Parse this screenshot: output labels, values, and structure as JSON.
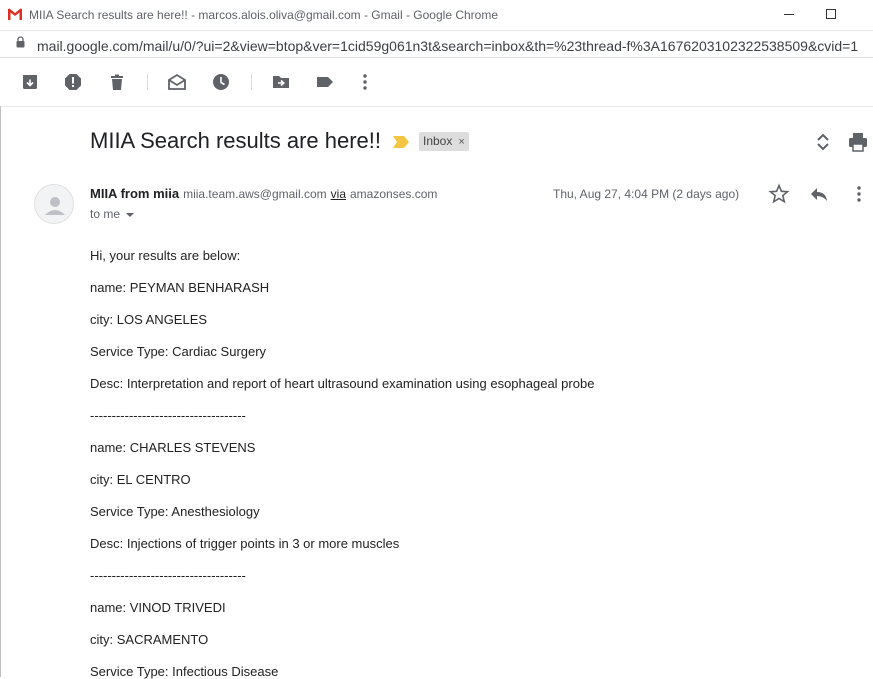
{
  "window": {
    "title": "MIIA Search results are here!! - marcos.alois.oliva@gmail.com - Gmail - Google Chrome"
  },
  "address_bar": {
    "url": "mail.google.com/mail/u/0/?ui=2&view=btop&ver=1cid59g061n3t&search=inbox&th=%23thread-f%3A1676203102322538509&cvid=1"
  },
  "toolbar": {
    "icons": [
      "archive-icon",
      "report-spam-icon",
      "delete-icon",
      "mark-unread-icon",
      "snooze-icon",
      "move-to-icon",
      "labels-icon",
      "more-vert-icon"
    ]
  },
  "email": {
    "subject": "MIIA Search results are here!!",
    "label": "Inbox",
    "label_close": "×",
    "sender_name": "MIIA from miia",
    "sender_email": "miia.team.aws@gmail.com",
    "via_label": "via",
    "via_domain": "amazonses.com",
    "recipient": "to me",
    "date": "Thu, Aug 27, 4:04 PM (2 days ago)",
    "body": [
      "Hi, your results are below:",
      "name: PEYMAN BENHARASH",
      "city: LOS ANGELES",
      "Service Type: Cardiac Surgery",
      "Desc: Interpretation and report of heart ultrasound examination using esophageal probe",
      "------------------------------------",
      "name: CHARLES STEVENS",
      "city: EL CENTRO",
      "Service Type: Anesthesiology",
      "Desc: Injections of trigger points in 3 or more muscles",
      "------------------------------------",
      "name: VINOD TRIVEDI",
      "city: SACRAMENTO",
      "Service Type: Infectious Disease"
    ]
  },
  "colors": {
    "gmail_red": "#d93025",
    "importance_yellow": "#f4c542",
    "icon_gray": "#5f6368"
  }
}
